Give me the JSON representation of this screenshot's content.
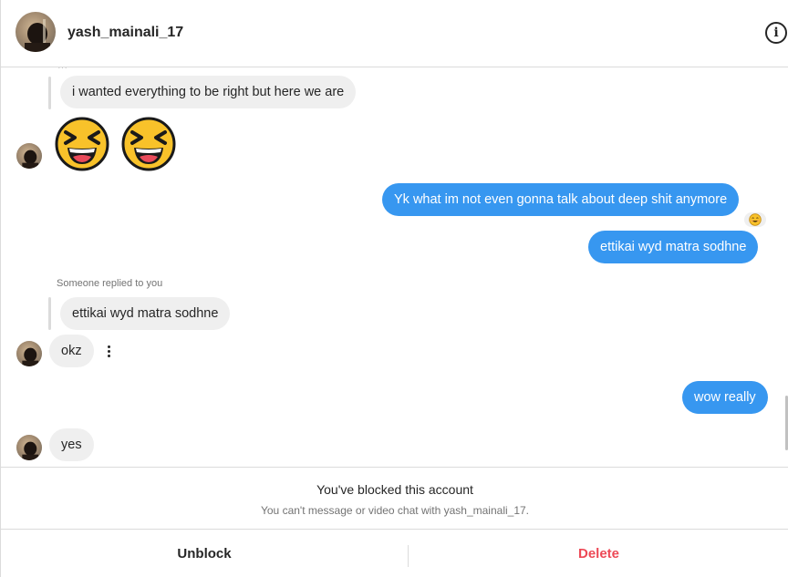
{
  "header": {
    "username": "yash_mainali_17",
    "info_icon": "info-icon"
  },
  "thread": {
    "messages": [
      {
        "sender": "them",
        "kind": "reply",
        "text": "i wanted everything to be right but here we are"
      },
      {
        "sender": "them",
        "kind": "emoji",
        "emoji": [
          "laughing-face-emoji",
          "laughing-face-emoji"
        ]
      },
      {
        "sender": "me",
        "text": "Yk what im not even gonna talk about deep shit anymore",
        "reaction": "smiling-face-emoji"
      },
      {
        "sender": "me",
        "text": "ettikai wyd matra sodhne"
      },
      {
        "sender": "them",
        "kind": "reply",
        "reply_label": "Someone replied to you",
        "quoted": "ettikai wyd matra sodhne",
        "text": "okz"
      },
      {
        "sender": "me",
        "text": "wow really"
      },
      {
        "sender": "them",
        "text": "yes"
      }
    ]
  },
  "blocked": {
    "title": "You've blocked this account",
    "subtitle": "You can't message or video chat with yash_mainali_17."
  },
  "actions": {
    "unblock": "Unblock",
    "delete": "Delete"
  },
  "colors": {
    "sent_bubble": "#3797f0",
    "received_bubble": "#efefef",
    "delete_text": "#ed4956"
  }
}
